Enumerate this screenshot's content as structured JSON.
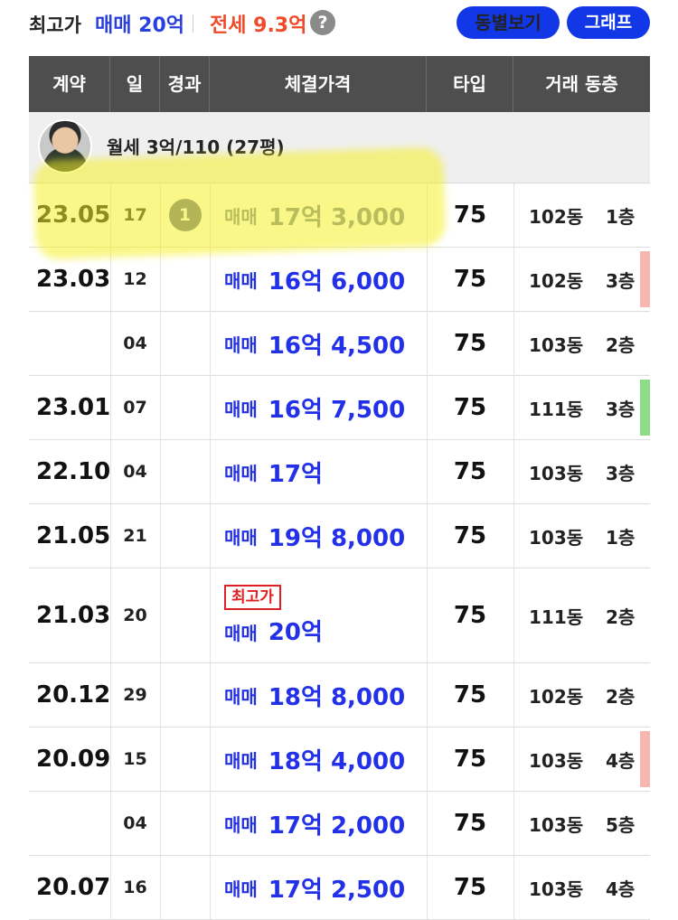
{
  "summary": {
    "label": "최고가",
    "sale": "매매 20억",
    "jeonse": "전세 9.3억",
    "help_icon": "?",
    "dong_button": "동별보기",
    "graph_button": "그래프"
  },
  "table": {
    "headers": [
      "계약",
      "일",
      "경과",
      "체결가격",
      "타입",
      "거래 동층"
    ],
    "rent_row": "월세 3억/110 (27평)",
    "rows": [
      {
        "date": "23.05",
        "day": "17",
        "badge": "1",
        "kind": "매매",
        "amount": "17억 3,000",
        "type": "75",
        "dong": "102동",
        "floor": "1층"
      },
      {
        "date": "23.03",
        "day": "12",
        "kind": "매매",
        "amount": "16억 6,000",
        "type": "75",
        "dong": "102동",
        "floor": "3층",
        "marker": "#f6b7b0"
      },
      {
        "date": "",
        "day": "04",
        "kind": "매매",
        "amount": "16억 4,500",
        "type": "75",
        "dong": "103동",
        "floor": "2층"
      },
      {
        "date": "23.01",
        "day": "07",
        "kind": "매매",
        "amount": "16억 7,500",
        "type": "75",
        "dong": "111동",
        "floor": "3층",
        "marker": "#8edc8a"
      },
      {
        "date": "22.10",
        "day": "04",
        "kind": "매매",
        "amount": "17억",
        "type": "75",
        "dong": "103동",
        "floor": "3층"
      },
      {
        "date": "21.05",
        "day": "21",
        "kind": "매매",
        "amount": "19억 8,000",
        "type": "75",
        "dong": "103동",
        "floor": "1층"
      },
      {
        "date": "21.03",
        "day": "20",
        "max_label": "최고가",
        "kind": "매매",
        "amount": "20억",
        "type": "75",
        "dong": "111동",
        "floor": "2층"
      },
      {
        "date": "20.12",
        "day": "29",
        "kind": "매매",
        "amount": "18억 8,000",
        "type": "75",
        "dong": "102동",
        "floor": "2층"
      },
      {
        "date": "20.09",
        "day": "15",
        "kind": "매매",
        "amount": "18억 4,000",
        "type": "75",
        "dong": "103동",
        "floor": "4층",
        "marker": "#f6b7b0"
      },
      {
        "date": "",
        "day": "04",
        "kind": "매매",
        "amount": "17억 2,000",
        "type": "75",
        "dong": "103동",
        "floor": "5층"
      },
      {
        "date": "20.07",
        "day": "16",
        "kind": "매매",
        "amount": "17억 2,500",
        "type": "75",
        "dong": "103동",
        "floor": "4층"
      }
    ]
  }
}
